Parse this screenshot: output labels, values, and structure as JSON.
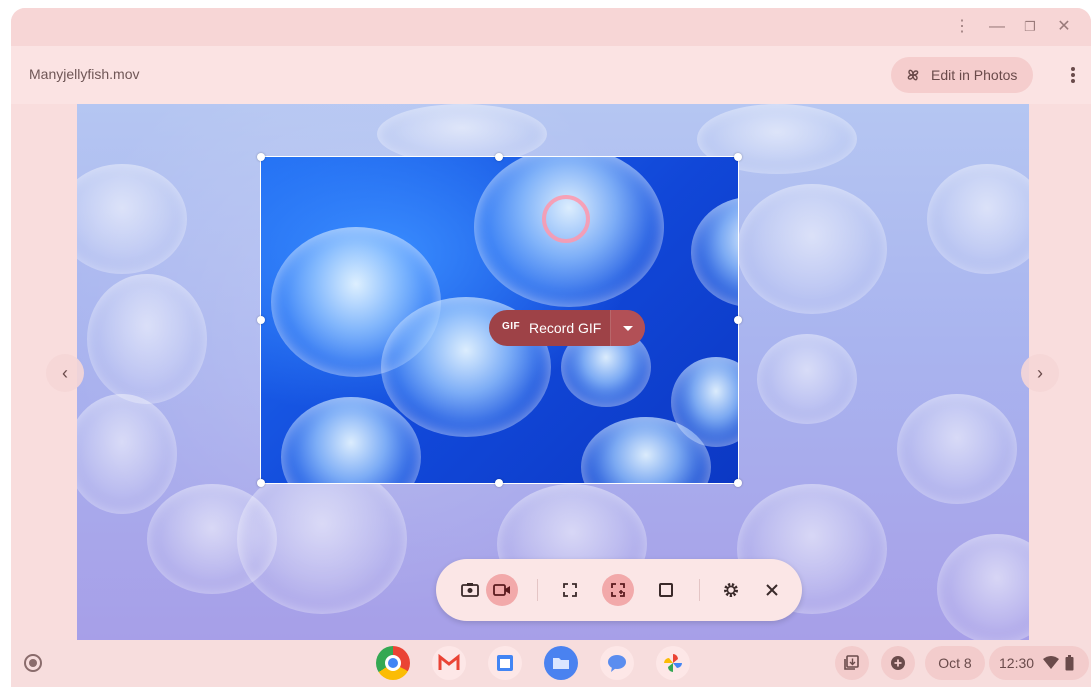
{
  "window": {
    "controls": [
      "more-vert-icon",
      "minimize-icon",
      "restore-icon",
      "close-icon"
    ]
  },
  "appbar": {
    "filename": "Manyjellyfish.mov",
    "edit_label": "Edit in Photos"
  },
  "record": {
    "gif_badge": "GIF",
    "label": "Record GIF"
  },
  "capture_bar": {
    "items": [
      "screenshot-icon",
      "screen-record-icon",
      "fullscreen-capture-icon",
      "partial-capture-icon",
      "window-capture-icon",
      "settings-icon",
      "close-icon"
    ],
    "active": [
      "screen-record-icon",
      "partial-capture-icon"
    ]
  },
  "shelf": {
    "apps": [
      "chrome",
      "gmail",
      "calendar",
      "files",
      "messages",
      "photos"
    ],
    "date": "Oct 8",
    "time": "12:30"
  },
  "colors": {
    "record_button": "#9e4247",
    "active_capture": "#f2a9aa",
    "frame_bg": "#f7dcdc"
  }
}
